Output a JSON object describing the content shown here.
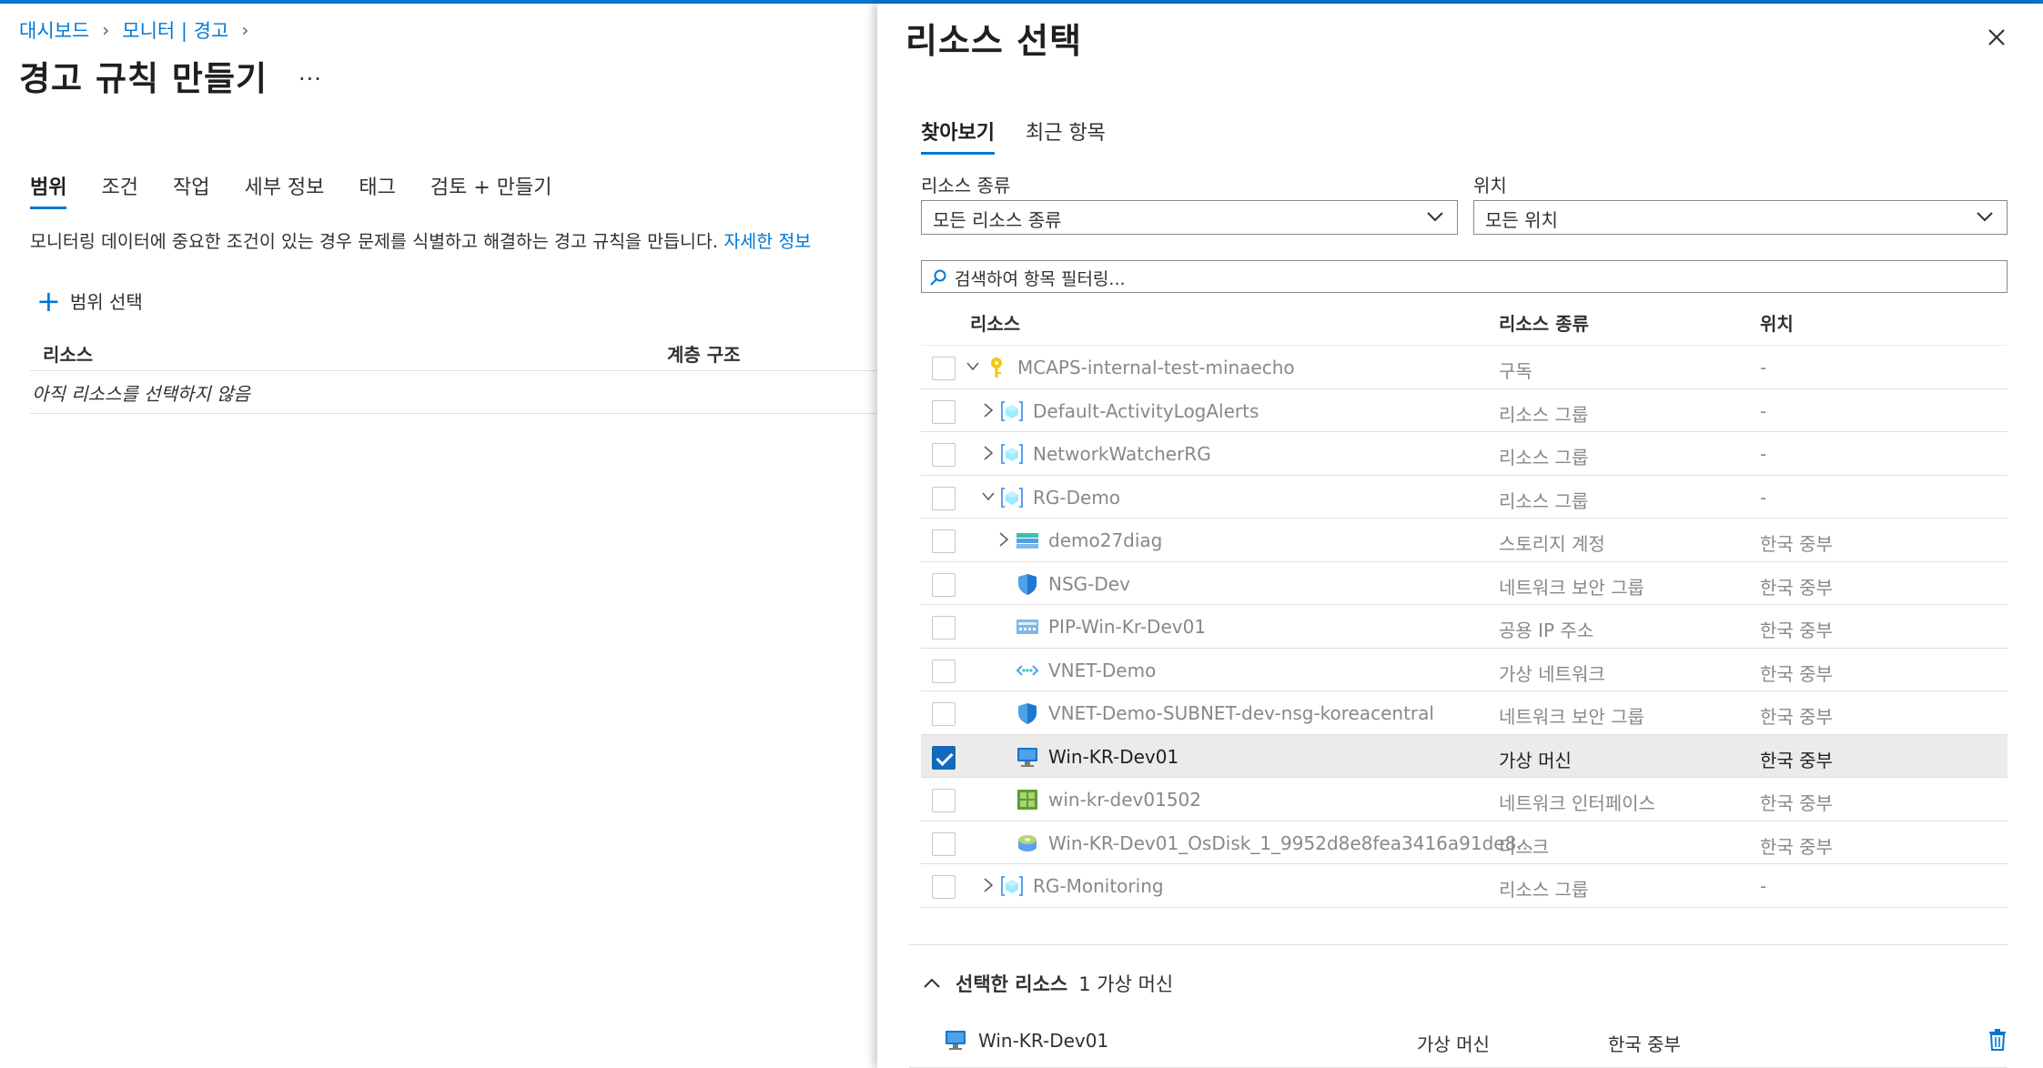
{
  "breadcrumb": {
    "items": [
      "대시보드",
      "모니터 | 경고"
    ]
  },
  "page": {
    "title": "경고 규칙 만들기",
    "more": "...",
    "tabs": [
      "범위",
      "조건",
      "작업",
      "세부 정보",
      "태그",
      "검토 + 만들기"
    ],
    "active_tab": "범위",
    "description": "모니터링 데이터에 중요한 조건이 있는 경우 문제를 식별하고 해결하는 경고 규칙을 만듭니다.",
    "learn_more": "자세한 정보",
    "select_scope": "범위 선택",
    "table": {
      "col_resource": "리소스",
      "col_hierarchy": "계층 구조",
      "empty": "아직 리소스를 선택하지 않음"
    }
  },
  "blade": {
    "title": "리소스 선택",
    "tabs": [
      "찾아보기",
      "최근 항목"
    ],
    "active_tab": "찾아보기",
    "filter_type_label": "리소스 종류",
    "filter_type_value": "모든 리소스 종류",
    "filter_location_label": "위치",
    "filter_location_value": "모든 위치",
    "search_placeholder": "검색하여 항목 필터링...",
    "columns": {
      "resource": "리소스",
      "type": "리소스 종류",
      "location": "위치"
    },
    "rows": [
      {
        "name": "MCAPS-internal-test-minaecho",
        "type": "구독",
        "location": "-",
        "level": 0,
        "expander": "open",
        "icon": "key-icon",
        "checked": false
      },
      {
        "name": "Default-ActivityLogAlerts",
        "type": "리소스 그룹",
        "location": "-",
        "level": 1,
        "expander": "closed",
        "icon": "resource-group-icon",
        "checked": false
      },
      {
        "name": "NetworkWatcherRG",
        "type": "리소스 그룹",
        "location": "-",
        "level": 1,
        "expander": "closed",
        "icon": "resource-group-icon",
        "checked": false
      },
      {
        "name": "RG-Demo",
        "type": "리소스 그룹",
        "location": "-",
        "level": 1,
        "expander": "open",
        "icon": "resource-group-icon",
        "checked": false
      },
      {
        "name": "demo27diag",
        "type": "스토리지 계정",
        "location": "한국 중부",
        "level": 2,
        "expander": "closed",
        "icon": "storage-account-icon",
        "checked": false
      },
      {
        "name": "NSG-Dev",
        "type": "네트워크 보안 그룹",
        "location": "한국 중부",
        "level": 2,
        "expander": "none",
        "icon": "shield-icon",
        "checked": false
      },
      {
        "name": "PIP-Win-Kr-Dev01",
        "type": "공용 IP 주소",
        "location": "한국 중부",
        "level": 2,
        "expander": "none",
        "icon": "public-ip-icon",
        "checked": false
      },
      {
        "name": "VNET-Demo",
        "type": "가상 네트워크",
        "location": "한국 중부",
        "level": 2,
        "expander": "none",
        "icon": "vnet-icon",
        "checked": false
      },
      {
        "name": "VNET-Demo-SUBNET-dev-nsg-koreacentral",
        "type": "네트워크 보안 그룹",
        "location": "한국 중부",
        "level": 2,
        "expander": "none",
        "icon": "shield-icon",
        "checked": false
      },
      {
        "name": "Win-KR-Dev01",
        "type": "가상 머신",
        "location": "한국 중부",
        "level": 2,
        "expander": "none",
        "icon": "vm-icon",
        "checked": true
      },
      {
        "name": "win-kr-dev01502",
        "type": "네트워크 인터페이스",
        "location": "한국 중부",
        "level": 2,
        "expander": "none",
        "icon": "nic-icon",
        "checked": false
      },
      {
        "name": "Win-KR-Dev01_OsDisk_1_9952d8e8fea3416a91de8...",
        "type": "디스크",
        "location": "한국 중부",
        "level": 2,
        "expander": "none",
        "icon": "disk-icon",
        "checked": false
      },
      {
        "name": "RG-Monitoring",
        "type": "리소스 그룹",
        "location": "-",
        "level": 1,
        "expander": "closed",
        "icon": "resource-group-icon",
        "checked": false
      }
    ],
    "selected_title": "선택한 리소스",
    "selected_count": "1 가상 머신",
    "selected_item": {
      "name": "Win-KR-Dev01",
      "type": "가상 머신",
      "location": "한국 중부"
    }
  }
}
